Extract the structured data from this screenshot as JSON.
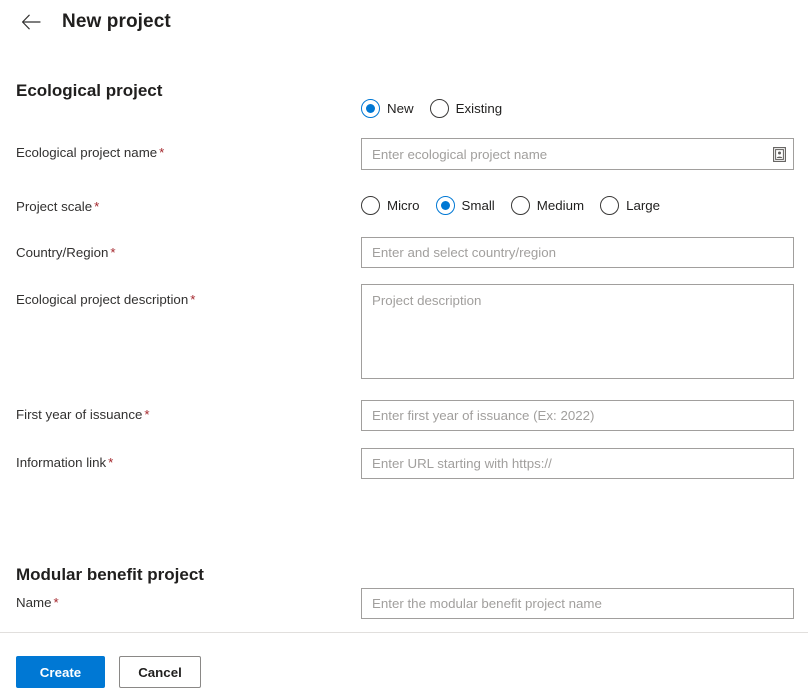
{
  "header": {
    "back_icon": "arrow-left-icon",
    "title": "New project"
  },
  "sections": {
    "ecological": {
      "title": "Ecological project",
      "mode": {
        "options": [
          {
            "label": "New",
            "checked": true
          },
          {
            "label": "Existing",
            "checked": false
          }
        ]
      },
      "project_name": {
        "label": "Ecological project name",
        "required": "*",
        "value": "",
        "placeholder": "Enter ecological project name",
        "icon": "book-contact-icon"
      },
      "project_scale": {
        "label": "Project scale",
        "required": "*",
        "options": [
          {
            "label": "Micro",
            "checked": false
          },
          {
            "label": "Small",
            "checked": true
          },
          {
            "label": "Medium",
            "checked": false
          },
          {
            "label": "Large",
            "checked": false
          }
        ]
      },
      "country_region": {
        "label": "Country/Region",
        "required": "*",
        "value": "",
        "placeholder": "Enter and select country/region"
      },
      "description": {
        "label": "Ecological project description",
        "required": "*",
        "value": "",
        "placeholder": "Project description"
      },
      "first_year": {
        "label": "First year of issuance",
        "required": "*",
        "value": "",
        "placeholder": "Enter first year of issuance (Ex: 2022)"
      },
      "information_link": {
        "label": "Information link",
        "required": "*",
        "value": "",
        "placeholder": "Enter URL starting with https://"
      }
    },
    "modular": {
      "title": "Modular benefit project",
      "name": {
        "label": "Name",
        "required": "*",
        "value": "",
        "placeholder": "Enter the modular benefit project name"
      }
    }
  },
  "footer": {
    "create_label": "Create",
    "cancel_label": "Cancel"
  },
  "colors": {
    "accent": "#0078d4",
    "required_asterisk": "#a4262c",
    "field_border": "#a19f9d",
    "text": "#201f1e"
  }
}
